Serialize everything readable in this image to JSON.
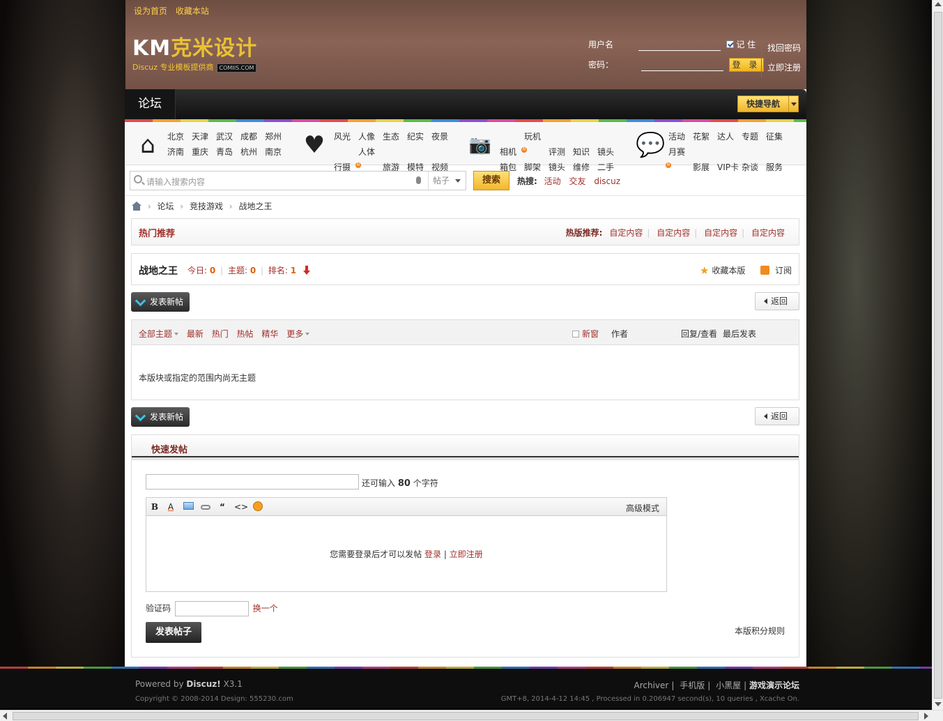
{
  "top_links": [
    "设为首页",
    "收藏本站"
  ],
  "logo": {
    "mark_a": "KM",
    "mark_b": "克米设计",
    "tagline": "Discuz 专业模板提供商",
    "domain": "COMIIS.COM"
  },
  "login": {
    "username_label": "用户名",
    "password_label": "密码：",
    "remember": "记 住",
    "submit": "登 录",
    "find_password": "找回密码",
    "register": "立即注册"
  },
  "nav": {
    "forum": "论坛",
    "quick_nav": "快捷导航"
  },
  "categories": [
    {
      "icon": "home-icon",
      "rows": [
        [
          "北京",
          "天津",
          "武汉",
          "成都",
          "郑州"
        ],
        [
          "济南",
          "重庆",
          "青岛",
          "杭州",
          "南京"
        ]
      ]
    },
    {
      "icon": "heart-icon",
      "rows": [
        [
          "风光",
          "人像",
          "生态",
          "纪实",
          "夜景"
        ],
        [
          "行摄",
          "人体",
          "旅游",
          "模特",
          "视频"
        ]
      ]
    },
    {
      "icon": "camera-icon",
      "rows": [
        [
          "相机",
          "玩机",
          "评测",
          "知识",
          "镜头"
        ],
        [
          "箱包",
          "脚架",
          "镜头",
          "维修",
          "二手"
        ]
      ]
    },
    {
      "icon": "chat-icon",
      "rows": [
        [
          "活动",
          "花絮",
          "达人",
          "专题",
          "征集"
        ],
        [
          "月赛",
          "影展",
          "VIP卡",
          "杂谈",
          "服务"
        ]
      ]
    }
  ],
  "search": {
    "placeholder": "请输入搜索内容",
    "type": "帖子",
    "button": "搜索",
    "hot_label": "热搜:",
    "hot": [
      "活动",
      "交友",
      "discuz"
    ]
  },
  "breadcrumb": [
    "论坛",
    "竞技游戏",
    "战地之王"
  ],
  "hot_recommend": {
    "title": "热门推荐",
    "label": "热版推荐:",
    "items": [
      "自定内容",
      "自定内容",
      "自定内容",
      "自定内容"
    ]
  },
  "forum": {
    "name": "战地之王",
    "today_label": "今日:",
    "today": "0",
    "topics_label": "主题:",
    "topics": "0",
    "rank_label": "排名:",
    "rank": "1",
    "favorite": "收藏本版",
    "subscribe": "订阅"
  },
  "post_new": "发表新帖",
  "back": "返回",
  "thread_list": {
    "filters": [
      "全部主题",
      "最新",
      "热门",
      "热帖",
      "精华",
      "更多"
    ],
    "new_window": "新窗",
    "author": "作者",
    "replies": "回复/查看",
    "last_post": "最后发表",
    "empty": "本版块或指定的范围内尚无主题"
  },
  "fastpost": {
    "title": "快速发帖",
    "remaining_prefix": "还可输入",
    "remaining": "80",
    "remaining_suffix": "个字符",
    "advanced": "高级模式",
    "login_msg": "您需要登录后才可以发帖",
    "login": "登录",
    "sep": "|",
    "register": "立即注册",
    "captcha_label": "验证码",
    "captcha_change": "换一个",
    "submit": "发表帖子",
    "rules": "本版积分规则"
  },
  "footer": {
    "powered_prefix": "Powered by",
    "powered_name": "Discuz!",
    "version": "X3.1",
    "copyright": "Copyright © 2008-2014 Design: 555230.com",
    "links": [
      "Archiver",
      "手机版",
      "小黑屋"
    ],
    "site": "游戏演示论坛",
    "gmt": "GMT+8, 2014-4-12 14:45 , Processed in 0.206947 second(s), 10 queries , Xcache On."
  }
}
